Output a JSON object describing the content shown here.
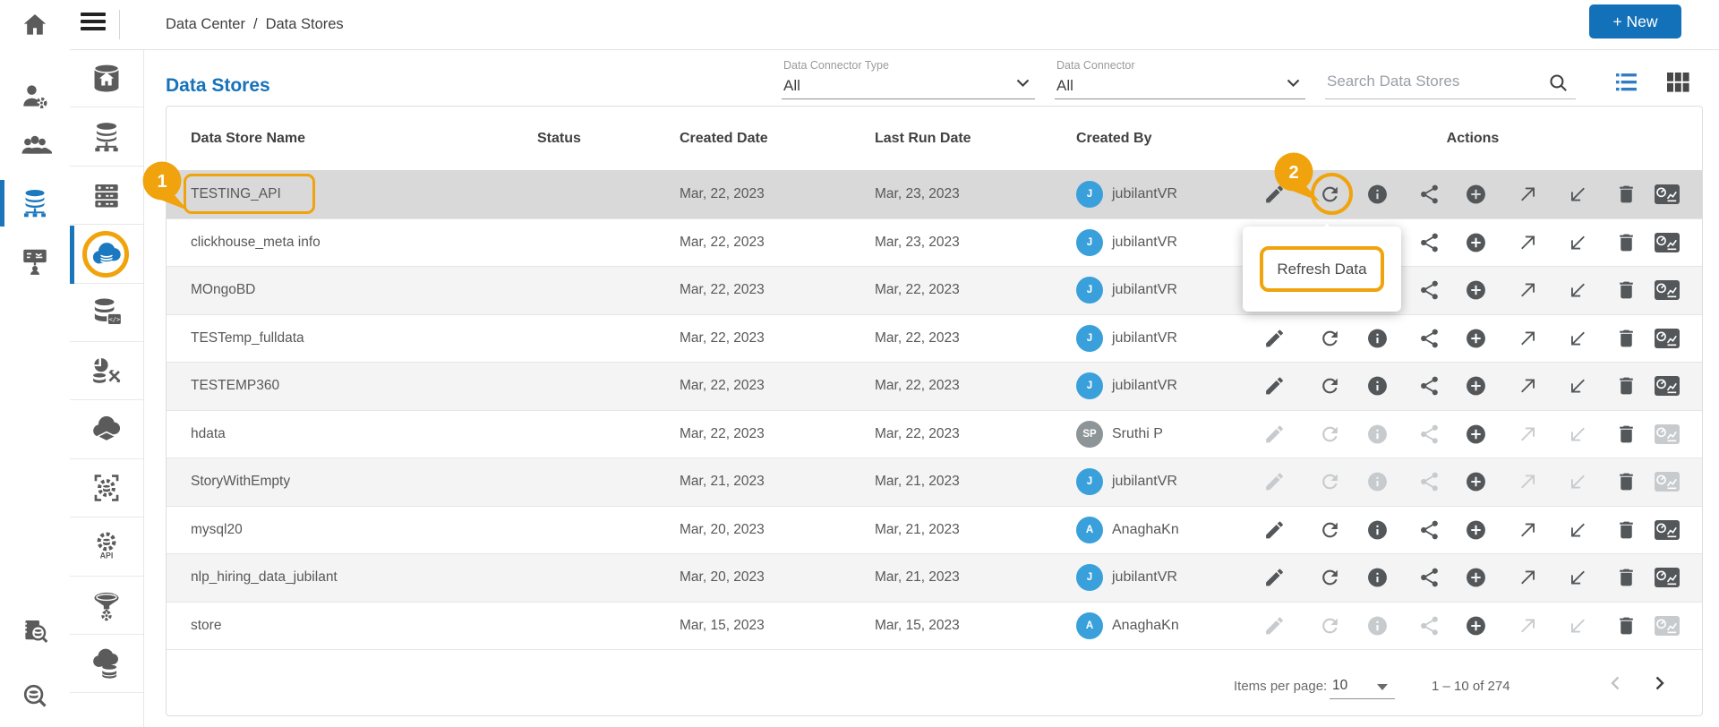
{
  "topbar": {
    "breadcrumb": {
      "parent": "Data Center",
      "separator": "/",
      "current": "Data Stores"
    },
    "new_button_label": "+ New"
  },
  "page": {
    "title": "Data Stores"
  },
  "sidebar_primary": {
    "items": [
      "home",
      "user-settings",
      "user-groups",
      "data-stores",
      "presentations"
    ],
    "bottom_items": [
      "data-discovery",
      "data-search"
    ],
    "active_item": "data-stores"
  },
  "sidebar_secondary": {
    "items": [
      "data-center-home",
      "databases",
      "servers",
      "data-stores",
      "dataset-code",
      "data-sync",
      "cloud-layers",
      "data-engine",
      "api-services",
      "data-funnel",
      "cloud-database"
    ],
    "active_item": "data-stores"
  },
  "filters": {
    "connector_type": {
      "label": "Data Connector Type",
      "value": "All"
    },
    "connector": {
      "label": "Data Connector",
      "value": "All"
    },
    "search_placeholder": "Search Data Stores"
  },
  "table": {
    "columns": [
      "Data Store Name",
      "Status",
      "Created Date",
      "Last Run Date",
      "Created By",
      "Actions"
    ],
    "action_icons": [
      "edit",
      "refresh",
      "info",
      "share",
      "add",
      "open-external",
      "import",
      "delete",
      "data-profile"
    ],
    "rows": [
      {
        "name": "TESTING_API",
        "status": "",
        "created": "Mar, 22, 2023",
        "last_run": "Mar, 23, 2023",
        "creator": {
          "initials": "J",
          "name": "jubilantVR",
          "color": "#3AA0DC"
        },
        "selected": true,
        "actions_disabled": false
      },
      {
        "name": "clickhouse_meta info",
        "status": "",
        "created": "Mar, 22, 2023",
        "last_run": "Mar, 23, 2023",
        "creator": {
          "initials": "J",
          "name": "jubilantVR",
          "color": "#3AA0DC"
        },
        "selected": false,
        "actions_disabled": false
      },
      {
        "name": "MOngoBD",
        "status": "",
        "created": "Mar, 22, 2023",
        "last_run": "Mar, 22, 2023",
        "creator": {
          "initials": "J",
          "name": "jubilantVR",
          "color": "#3AA0DC"
        },
        "selected": false,
        "actions_disabled": false
      },
      {
        "name": "TESTemp_fulldata",
        "status": "",
        "created": "Mar, 22, 2023",
        "last_run": "Mar, 22, 2023",
        "creator": {
          "initials": "J",
          "name": "jubilantVR",
          "color": "#3AA0DC"
        },
        "selected": false,
        "actions_disabled": false
      },
      {
        "name": "TESTEMP360",
        "status": "",
        "created": "Mar, 22, 2023",
        "last_run": "Mar, 22, 2023",
        "creator": {
          "initials": "J",
          "name": "jubilantVR",
          "color": "#3AA0DC"
        },
        "selected": false,
        "actions_disabled": false
      },
      {
        "name": "hdata",
        "status": "",
        "created": "Mar, 22, 2023",
        "last_run": "Mar, 22, 2023",
        "creator": {
          "initials": "SP",
          "name": "Sruthi P",
          "color": "#8D9598"
        },
        "selected": false,
        "actions_disabled": true
      },
      {
        "name": "StoryWithEmpty",
        "status": "",
        "created": "Mar, 21, 2023",
        "last_run": "Mar, 21, 2023",
        "creator": {
          "initials": "J",
          "name": "jubilantVR",
          "color": "#3AA0DC"
        },
        "selected": false,
        "actions_disabled": true
      },
      {
        "name": "mysql20",
        "status": "",
        "created": "Mar, 20, 2023",
        "last_run": "Mar, 21, 2023",
        "creator": {
          "initials": "A",
          "name": "AnaghaKn",
          "color": "#3AA0DC"
        },
        "selected": false,
        "actions_disabled": false
      },
      {
        "name": "nlp_hiring_data_jubilant",
        "status": "",
        "created": "Mar, 20, 2023",
        "last_run": "Mar, 21, 2023",
        "creator": {
          "initials": "J",
          "name": "jubilantVR",
          "color": "#3AA0DC"
        },
        "selected": false,
        "actions_disabled": false
      },
      {
        "name": "store",
        "status": "",
        "created": "Mar, 15, 2023",
        "last_run": "Mar, 15, 2023",
        "creator": {
          "initials": "A",
          "name": "AnaghaKn",
          "color": "#3AA0DC"
        },
        "selected": false,
        "actions_disabled": true
      }
    ]
  },
  "annotations": {
    "step1": "1",
    "step2": "2",
    "tooltip_text": "Refresh Data"
  },
  "pagination": {
    "items_per_page_label": "Items per page:",
    "items_per_page_value": "10",
    "range_text": "1 – 10 of 274"
  },
  "colors": {
    "accent_blue": "#1371B9",
    "active_icon_blue": "#1C79C0",
    "annotation_orange": "#F0A30C",
    "selected_row": "#D9D9D9",
    "avatar_blue": "#3AA0DC",
    "avatar_gray": "#8D9598"
  }
}
